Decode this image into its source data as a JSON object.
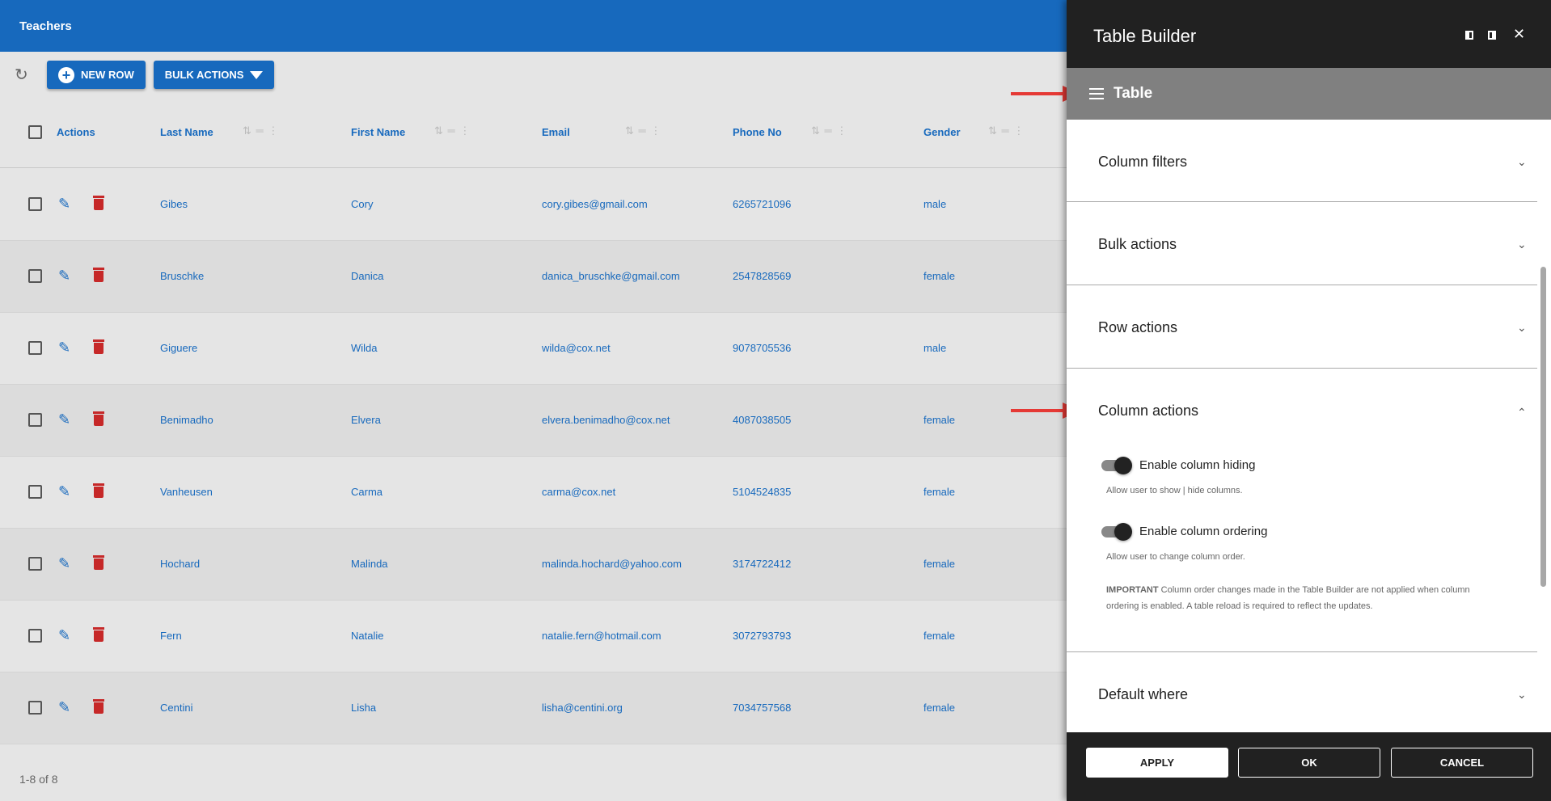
{
  "app": {
    "title": "Teachers"
  },
  "toolbar": {
    "new_row": "NEW ROW",
    "bulk_actions": "BULK ACTIONS"
  },
  "table": {
    "columns": [
      "Actions",
      "Last Name",
      "First Name",
      "Email",
      "Phone No",
      "Gender"
    ],
    "rows": [
      {
        "last": "Gibes",
        "first": "Cory",
        "email": "cory.gibes@gmail.com",
        "phone": "6265721096",
        "gender": "male"
      },
      {
        "last": "Bruschke",
        "first": "Danica",
        "email": "danica_bruschke@gmail.com",
        "phone": "2547828569",
        "gender": "female"
      },
      {
        "last": "Giguere",
        "first": "Wilda",
        "email": "wilda@cox.net",
        "phone": "9078705536",
        "gender": "male"
      },
      {
        "last": "Benimadho",
        "first": "Elvera",
        "email": "elvera.benimadho@cox.net",
        "phone": "4087038505",
        "gender": "female"
      },
      {
        "last": "Vanheusen",
        "first": "Carma",
        "email": "carma@cox.net",
        "phone": "5104524835",
        "gender": "female"
      },
      {
        "last": "Hochard",
        "first": "Malinda",
        "email": "malinda.hochard@yahoo.com",
        "phone": "3174722412",
        "gender": "female"
      },
      {
        "last": "Fern",
        "first": "Natalie",
        "email": "natalie.fern@hotmail.com",
        "phone": "3072793793",
        "gender": "female"
      },
      {
        "last": "Centini",
        "first": "Lisha",
        "email": "lisha@centini.org",
        "phone": "7034757568",
        "gender": "female"
      }
    ],
    "pagination": "1-8 of 8"
  },
  "panel": {
    "title": "Table Builder",
    "section_header": "Table",
    "sections": [
      "Column filters",
      "Bulk actions",
      "Row actions",
      "Column actions",
      "Default where"
    ],
    "column_actions": {
      "hiding_label": "Enable column hiding",
      "hiding_enabled": true,
      "hiding_desc": "Allow user to show | hide columns.",
      "ordering_label": "Enable column ordering",
      "ordering_enabled": true,
      "ordering_desc": "Allow user to change column order.",
      "important_strong": "IMPORTANT",
      "important_text": " Column order changes made in the Table Builder are not applied when column ordering is enabled. A table reload is required to reflect the updates."
    },
    "buttons": {
      "apply": "APPLY",
      "ok": "OK",
      "cancel": "CANCEL"
    }
  },
  "colors": {
    "primary": "#1769bd",
    "danger": "#c62828",
    "panel_dark": "#212121",
    "arrow": "#e53935"
  }
}
